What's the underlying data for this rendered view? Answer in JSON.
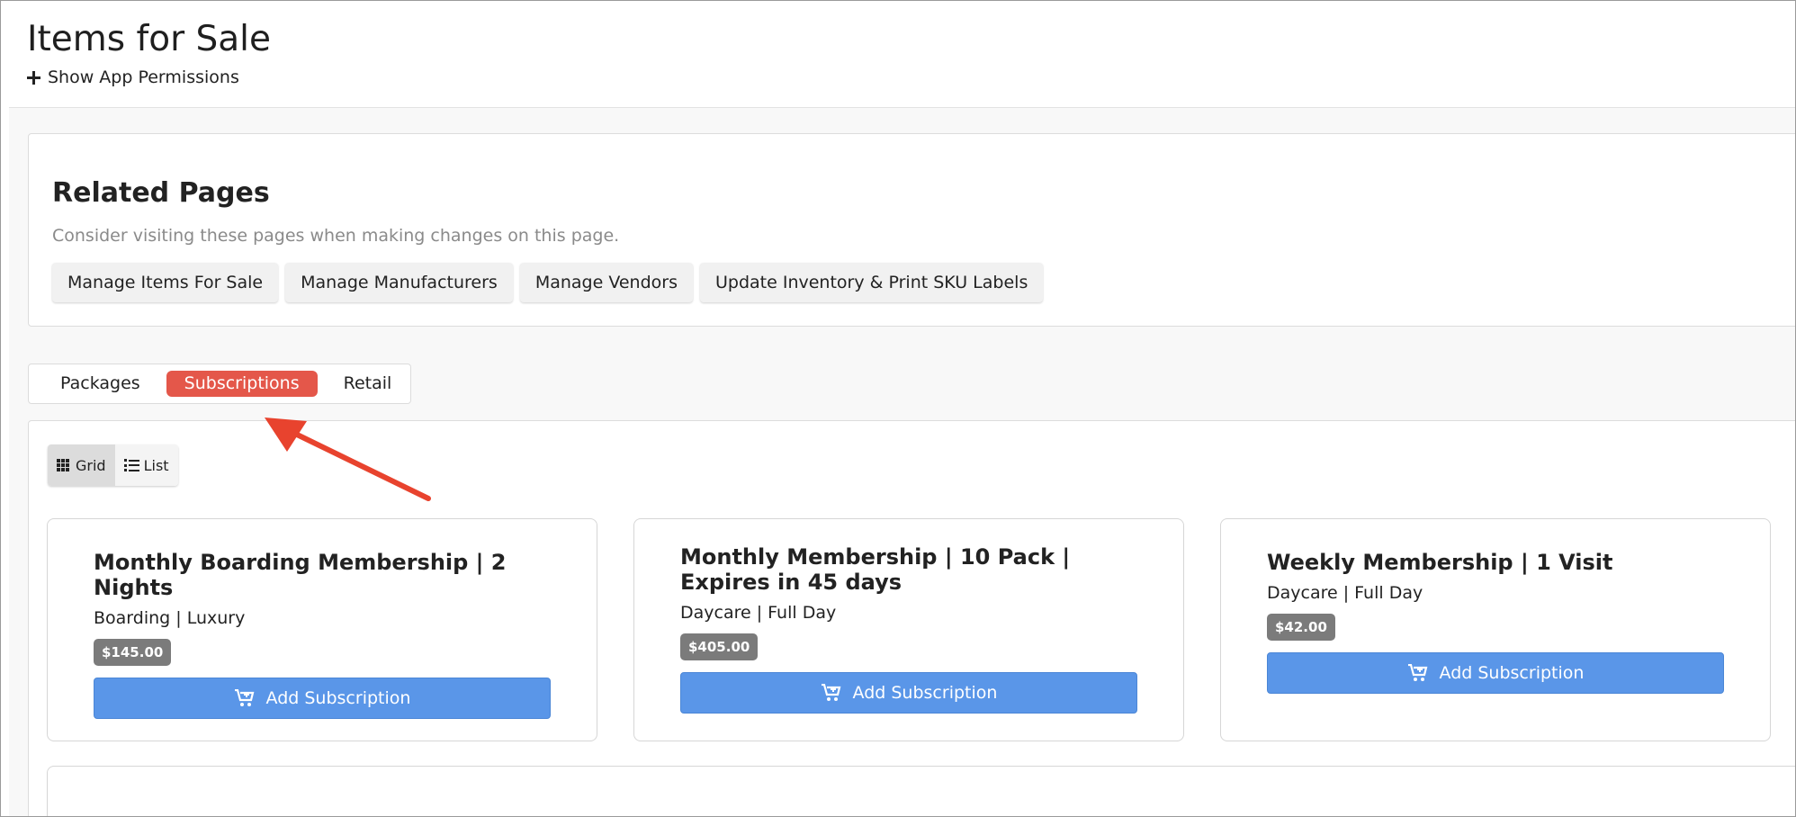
{
  "page": {
    "title": "Items for Sale",
    "permissions_toggle": "Show App Permissions"
  },
  "related": {
    "title": "Related Pages",
    "description": "Consider visiting these pages when making changes on this page.",
    "links": [
      "Manage Items For Sale",
      "Manage Manufacturers",
      "Manage Vendors",
      "Update Inventory & Print SKU Labels"
    ]
  },
  "tabs": {
    "items": [
      "Packages",
      "Subscriptions",
      "Retail"
    ],
    "active": "Subscriptions"
  },
  "view_toggle": {
    "grid_label": "Grid",
    "list_label": "List",
    "active": "Grid"
  },
  "cards": [
    {
      "title": "Monthly Boarding Membership | 2 Nights",
      "subtitle": "Boarding | Luxury",
      "price": "$145.00",
      "button_label": "Add Subscription"
    },
    {
      "title": "Monthly Membership | 10 Pack | Expires in 45 days",
      "subtitle": "Daycare | Full Day",
      "price": "$405.00",
      "button_label": "Add Subscription"
    },
    {
      "title": "Weekly Membership | 1 Visit",
      "subtitle": "Daycare | Full Day",
      "price": "$42.00",
      "button_label": "Add Subscription"
    }
  ],
  "icons": {
    "permissions": "plus-icon",
    "grid": "grid-icon",
    "list": "list-icon",
    "cart": "cart-plus-icon"
  },
  "colors": {
    "active_tab": "#e4574a",
    "primary_button": "#5a96e8",
    "price_badge": "#7b7b7b",
    "annotation_arrow": "#e8432e"
  }
}
